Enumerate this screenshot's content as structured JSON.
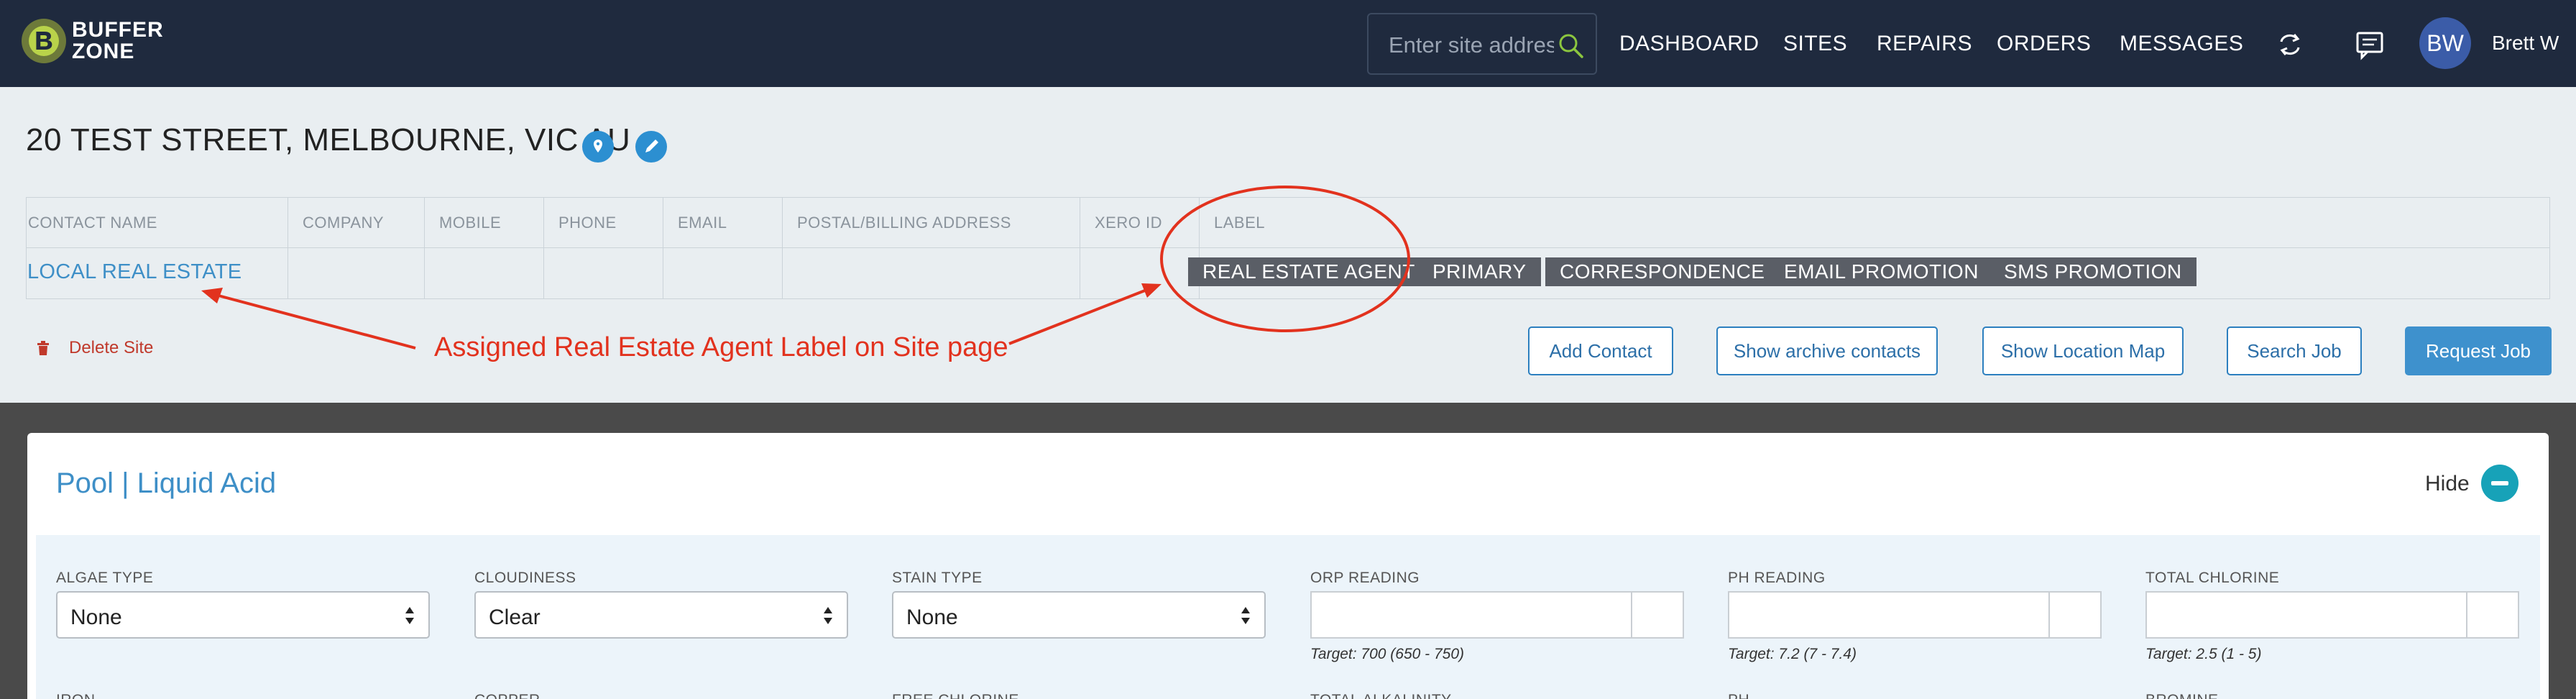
{
  "brand": {
    "line1": "BUFFER",
    "line2": "ZONE"
  },
  "search": {
    "placeholder": "Enter site address"
  },
  "nav": [
    "DASHBOARD",
    "SITES",
    "REPAIRS",
    "ORDERS",
    "MESSAGES"
  ],
  "user": {
    "initials": "BW",
    "name": "Brett W"
  },
  "site": {
    "title": "20 TEST STREET, MELBOURNE, VIC AU"
  },
  "contacts_table": {
    "headers": [
      "CONTACT NAME",
      "COMPANY",
      "MOBILE",
      "PHONE",
      "EMAIL",
      "POSTAL/BILLING ADDRESS",
      "XERO ID",
      "LABEL"
    ],
    "row": {
      "contact_name": "LOCAL REAL ESTATE"
    },
    "labels": [
      "REAL ESTATE AGENT",
      "PRIMARY",
      "CORRESPONDENCE",
      "EMAIL PROMOTION",
      "SMS PROMOTION"
    ]
  },
  "annotation": {
    "text": "Assigned Real Estate Agent Label on Site page",
    "color": "#e2321e"
  },
  "actions": {
    "delete": "Delete Site",
    "add_contact": "Add Contact",
    "show_archive": "Show archive contacts",
    "show_map": "Show Location Map",
    "search_job": "Search Job",
    "request_job": "Request Job"
  },
  "panel": {
    "title": "Pool | Liquid Acid",
    "hide": "Hide",
    "fields": [
      {
        "label": "ALGAE TYPE",
        "value": "None"
      },
      {
        "label": "CLOUDINESS",
        "value": "Clear"
      },
      {
        "label": "STAIN TYPE",
        "value": "None"
      }
    ],
    "readings": [
      {
        "label": "ORP READING",
        "target": "Target: 700 (650 - 750)"
      },
      {
        "label": "PH READING",
        "target": "Target: 7.2 (7 - 7.4)"
      },
      {
        "label": "TOTAL CHLORINE",
        "target": "Target: 2.5 (1 - 5)"
      }
    ],
    "next_row_labels": [
      "IRON",
      "COPPER",
      "FREE CHLORINE",
      "TOTAL ALKALINITY",
      "PH",
      "BROMINE"
    ]
  },
  "colors": {
    "nav_bg": "#1f2a3e",
    "accent": "#3e8fc7",
    "tag_bg": "#5a5e66",
    "danger": "#c0392b",
    "teal": "#17a2b8"
  }
}
